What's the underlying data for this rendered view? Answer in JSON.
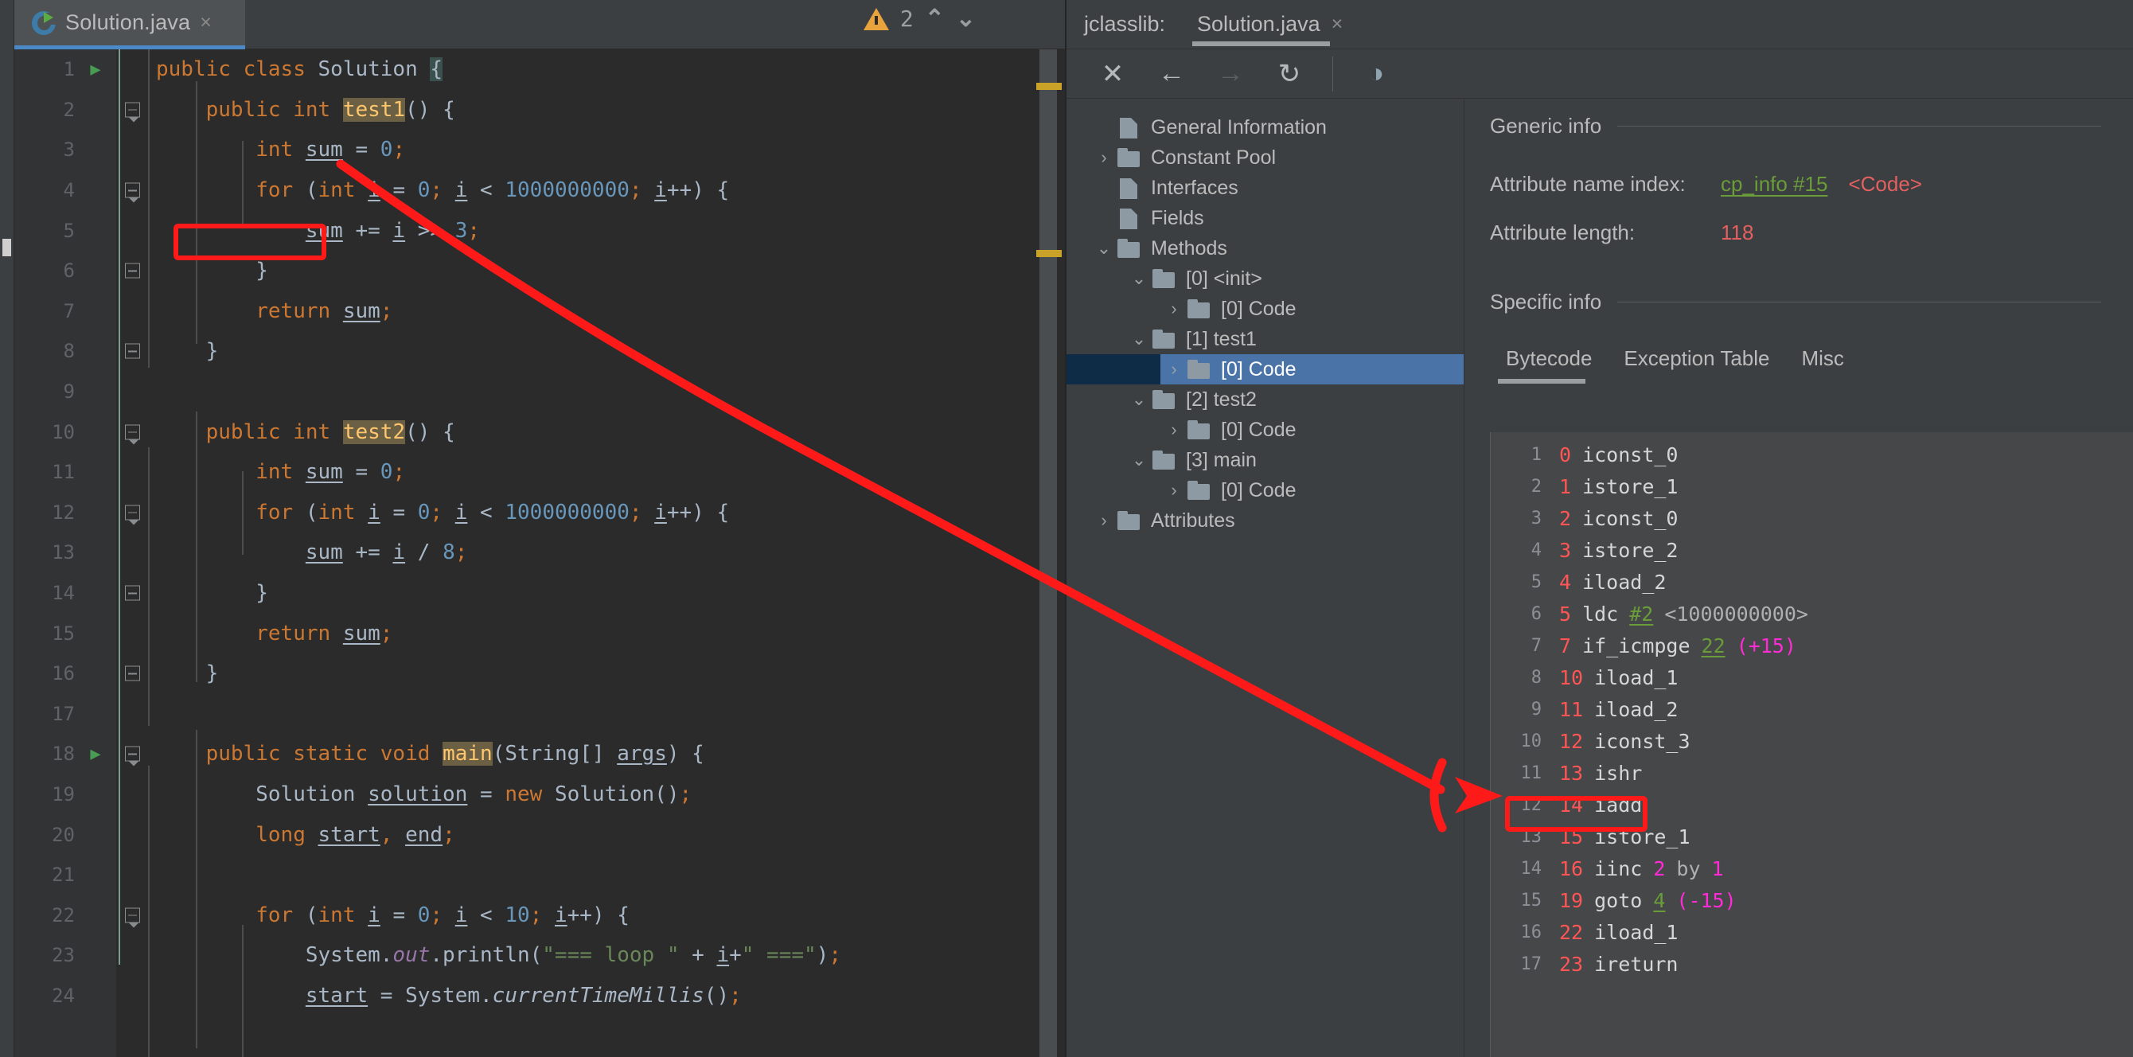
{
  "editor": {
    "tab": {
      "label": "Solution.java",
      "close": "×",
      "icon": "java-class-icon"
    },
    "warnings": {
      "count": "2",
      "icon": "warning-triangle-icon",
      "up": "⌃",
      "down": "⌄"
    },
    "lines": [
      {
        "n": "1",
        "run": "▶",
        "fold": "",
        "code": "public class Solution {"
      },
      {
        "n": "2",
        "run": "",
        "fold": "down",
        "code": "    public int test1() {"
      },
      {
        "n": "3",
        "run": "",
        "fold": "",
        "code": "        int sum = 0;"
      },
      {
        "n": "4",
        "run": "",
        "fold": "down",
        "code": "        for (int i = 0; i < 1000000000; i++) {"
      },
      {
        "n": "5",
        "run": "",
        "fold": "",
        "code": "            sum += i >> 3;"
      },
      {
        "n": "6",
        "run": "",
        "fold": "up",
        "code": "        }"
      },
      {
        "n": "7",
        "run": "",
        "fold": "",
        "code": "        return sum;"
      },
      {
        "n": "8",
        "run": "",
        "fold": "up",
        "code": "    }"
      },
      {
        "n": "9",
        "run": "",
        "fold": "",
        "code": ""
      },
      {
        "n": "10",
        "run": "",
        "fold": "down",
        "code": "    public int test2() {"
      },
      {
        "n": "11",
        "run": "",
        "fold": "",
        "code": "        int sum = 0;"
      },
      {
        "n": "12",
        "run": "",
        "fold": "down",
        "code": "        for (int i = 0; i < 1000000000; i++) {"
      },
      {
        "n": "13",
        "run": "",
        "fold": "",
        "code": "            sum += i / 8;"
      },
      {
        "n": "14",
        "run": "",
        "fold": "up",
        "code": "        }"
      },
      {
        "n": "15",
        "run": "",
        "fold": "",
        "code": "        return sum;"
      },
      {
        "n": "16",
        "run": "",
        "fold": "up",
        "code": "    }"
      },
      {
        "n": "17",
        "run": "",
        "fold": "",
        "code": ""
      },
      {
        "n": "18",
        "run": "▶",
        "fold": "down",
        "code": "    public static void main(String[] args) {"
      },
      {
        "n": "19",
        "run": "",
        "fold": "",
        "code": "        Solution solution = new Solution();"
      },
      {
        "n": "20",
        "run": "",
        "fold": "",
        "code": "        long start, end;"
      },
      {
        "n": "21",
        "run": "",
        "fold": "",
        "code": ""
      },
      {
        "n": "22",
        "run": "",
        "fold": "down",
        "code": "        for (int i = 0; i < 10; i++) {"
      },
      {
        "n": "23",
        "run": "",
        "fold": "",
        "code": "            System.out.println(\"=== loop \" + i+\" ===\");"
      },
      {
        "n": "24",
        "run": "",
        "fold": "",
        "code": "            start = System.currentTimeMillis();"
      }
    ]
  },
  "jclasslib": {
    "panel_title": "jclasslib:",
    "tab": {
      "label": "Solution.java",
      "close": "×"
    },
    "toolbar": [
      {
        "name": "close-icon",
        "glyph": "✕"
      },
      {
        "name": "back-icon",
        "glyph": "←"
      },
      {
        "name": "forward-icon",
        "glyph": "→"
      },
      {
        "name": "reload-icon",
        "glyph": "↻"
      },
      {
        "name": "browse-icon",
        "glyph": "◑"
      }
    ],
    "tree": [
      {
        "label": "General Information",
        "indent": 1,
        "twist": "",
        "icon": "file",
        "selected": false
      },
      {
        "label": "Constant Pool",
        "indent": 1,
        "twist": "›",
        "icon": "folder",
        "selected": false
      },
      {
        "label": "Interfaces",
        "indent": 1,
        "twist": "",
        "icon": "file",
        "selected": false
      },
      {
        "label": "Fields",
        "indent": 1,
        "twist": "",
        "icon": "file",
        "selected": false
      },
      {
        "label": "Methods",
        "indent": 1,
        "twist": "⌄",
        "icon": "folder",
        "selected": false
      },
      {
        "label": "[0] <init>",
        "indent": 2,
        "twist": "⌄",
        "icon": "folder",
        "selected": false
      },
      {
        "label": "[0] Code",
        "indent": 3,
        "twist": "›",
        "icon": "folder",
        "selected": false
      },
      {
        "label": "[1] test1",
        "indent": 2,
        "twist": "⌄",
        "icon": "folder",
        "selected": false
      },
      {
        "label": "[0] Code",
        "indent": 3,
        "twist": "›",
        "icon": "folder",
        "selected": true
      },
      {
        "label": "[2] test2",
        "indent": 2,
        "twist": "⌄",
        "icon": "folder",
        "selected": false
      },
      {
        "label": "[0] Code",
        "indent": 3,
        "twist": "›",
        "icon": "folder",
        "selected": false
      },
      {
        "label": "[3] main",
        "indent": 2,
        "twist": "⌄",
        "icon": "folder",
        "selected": false
      },
      {
        "label": "[0] Code",
        "indent": 3,
        "twist": "›",
        "icon": "folder",
        "selected": false
      },
      {
        "label": "Attributes",
        "indent": 1,
        "twist": "›",
        "icon": "folder",
        "selected": false
      }
    ],
    "generic_info": {
      "section_title": "Generic info",
      "name_index_key": "Attribute name index:",
      "name_index_link": "cp_info #15",
      "name_index_value": "<Code>",
      "length_key": "Attribute length:",
      "length_value": "118"
    },
    "specific_info": {
      "section_title": "Specific info",
      "tabs": [
        {
          "label": "Bytecode",
          "active": true
        },
        {
          "label": "Exception Table",
          "active": false
        },
        {
          "label": "Misc",
          "active": false
        }
      ]
    },
    "bytecode": [
      {
        "n": "1",
        "offset": "0",
        "op": "iconst_0",
        "ref": "",
        "cmt": "",
        "mag": ""
      },
      {
        "n": "2",
        "offset": "1",
        "op": "istore_1",
        "ref": "",
        "cmt": "",
        "mag": ""
      },
      {
        "n": "3",
        "offset": "2",
        "op": "iconst_0",
        "ref": "",
        "cmt": "",
        "mag": ""
      },
      {
        "n": "4",
        "offset": "3",
        "op": "istore_2",
        "ref": "",
        "cmt": "",
        "mag": ""
      },
      {
        "n": "5",
        "offset": "4",
        "op": "iload_2",
        "ref": "",
        "cmt": "",
        "mag": ""
      },
      {
        "n": "6",
        "offset": "5",
        "op": "ldc",
        "ref": "#2",
        "cmt": "<1000000000>",
        "mag": ""
      },
      {
        "n": "7",
        "offset": "7",
        "op": "if_icmpge",
        "ref": "22",
        "cmt": "",
        "mag": "(+15)"
      },
      {
        "n": "8",
        "offset": "10",
        "op": "iload_1",
        "ref": "",
        "cmt": "",
        "mag": ""
      },
      {
        "n": "9",
        "offset": "11",
        "op": "iload_2",
        "ref": "",
        "cmt": "",
        "mag": ""
      },
      {
        "n": "10",
        "offset": "12",
        "op": "iconst_3",
        "ref": "",
        "cmt": "",
        "mag": ""
      },
      {
        "n": "11",
        "offset": "13",
        "op": "ishr",
        "ref": "",
        "cmt": "",
        "mag": ""
      },
      {
        "n": "12",
        "offset": "14",
        "op": "iadd",
        "ref": "",
        "cmt": "",
        "mag": ""
      },
      {
        "n": "13",
        "offset": "15",
        "op": "istore_1",
        "ref": "",
        "cmt": "",
        "mag": ""
      },
      {
        "n": "14",
        "offset": "16",
        "op": "iinc",
        "ref": "",
        "cmt": "",
        "mag": "",
        "special": "iinc"
      },
      {
        "n": "15",
        "offset": "19",
        "op": "goto",
        "ref": "4",
        "cmt": "",
        "mag": "(-15)"
      },
      {
        "n": "16",
        "offset": "22",
        "op": "iload_1",
        "ref": "",
        "cmt": "",
        "mag": ""
      },
      {
        "n": "17",
        "offset": "23",
        "op": "ireturn",
        "ref": "",
        "cmt": "",
        "mag": ""
      }
    ],
    "iinc_parts": {
      "op": "iinc",
      "slot": "2",
      "by": "by",
      "amount": "1"
    }
  },
  "annotations": {
    "highlight_color": "#ff1a1a",
    "source_box_label": "sum += i >> 3;",
    "target_box_label": "13 ishr",
    "arrow": "red-arrow-annotation"
  }
}
